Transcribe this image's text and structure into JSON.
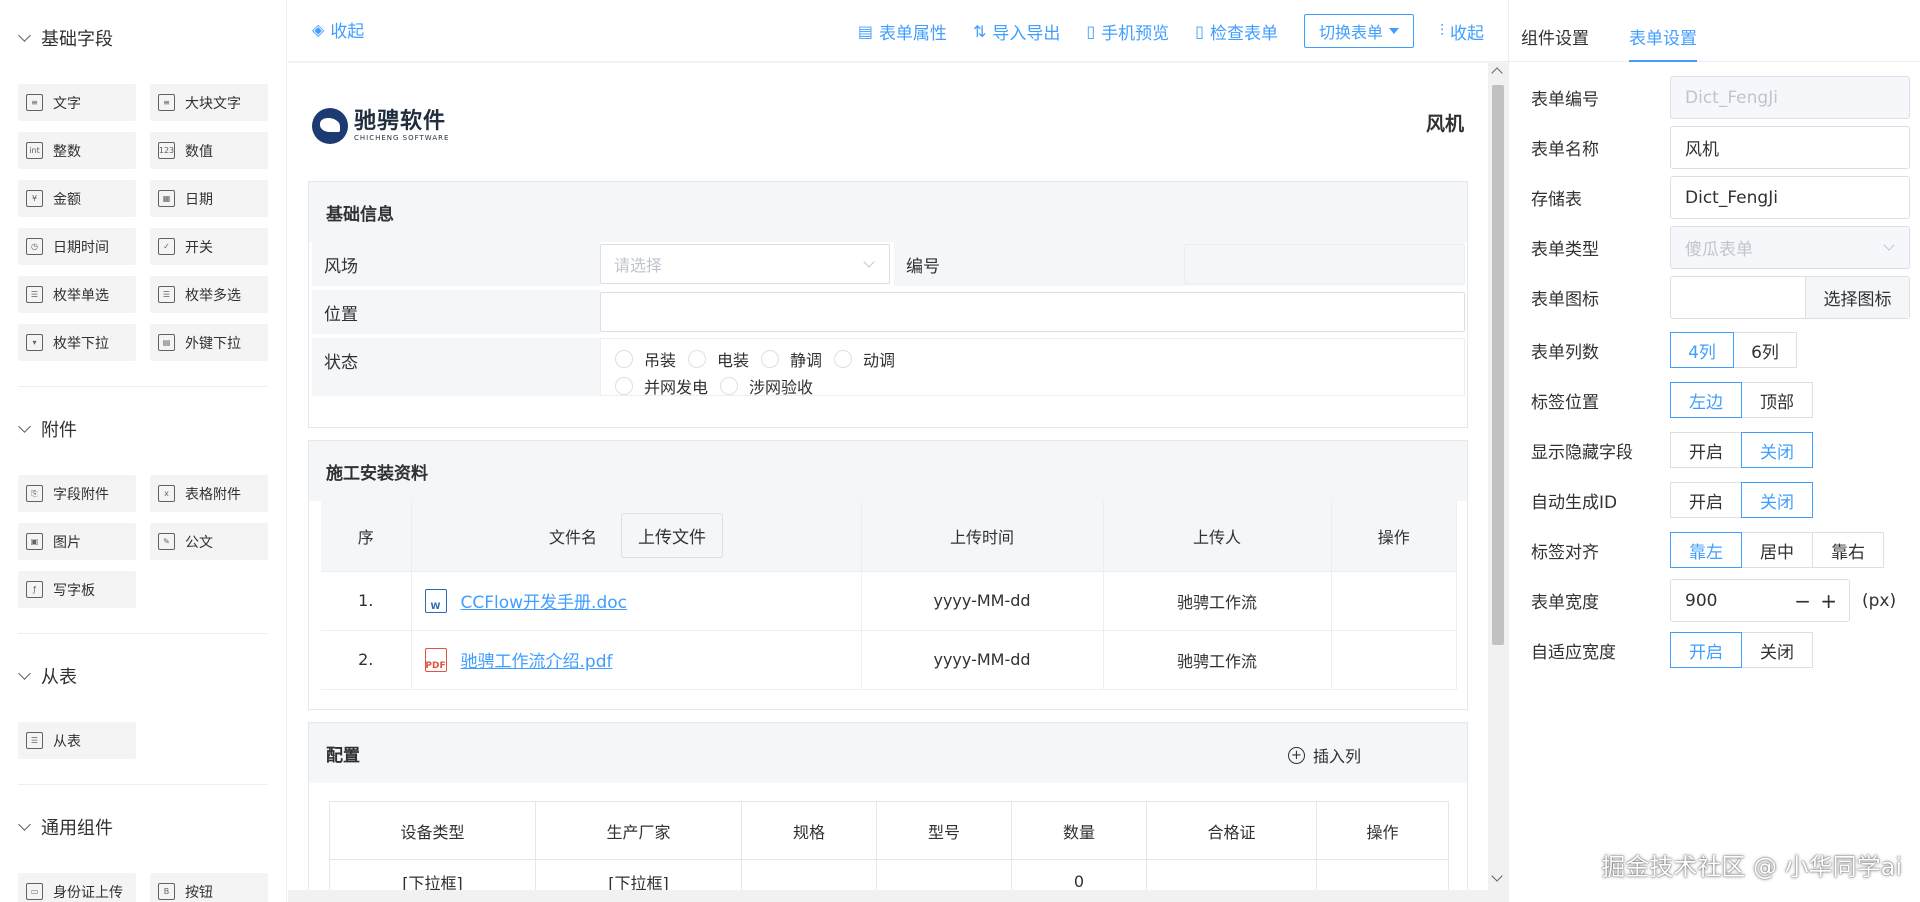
{
  "left": {
    "groups": [
      {
        "title": "基础字段",
        "items": [
          {
            "label": "文字",
            "icon": "text-icon"
          },
          {
            "label": "大块文字",
            "icon": "textarea-icon"
          },
          {
            "label": "整数",
            "icon": "int-icon"
          },
          {
            "label": "数值",
            "icon": "number-icon"
          },
          {
            "label": "金额",
            "icon": "money-icon"
          },
          {
            "label": "日期",
            "icon": "calendar-icon"
          },
          {
            "label": "日期时间",
            "icon": "datetime-icon"
          },
          {
            "label": "开关",
            "icon": "checkbox-icon"
          },
          {
            "label": "枚举单选",
            "icon": "radio-list-icon"
          },
          {
            "label": "枚举多选",
            "icon": "multi-select-icon"
          },
          {
            "label": "枚举下拉",
            "icon": "dropdown-icon"
          },
          {
            "label": "外键下拉",
            "icon": "foreign-key-icon"
          }
        ]
      },
      {
        "title": "附件",
        "items": [
          {
            "label": "字段附件",
            "icon": "file-icon"
          },
          {
            "label": "表格附件",
            "icon": "table-file-icon"
          },
          {
            "label": "图片",
            "icon": "image-icon"
          },
          {
            "label": "公文",
            "icon": "document-icon"
          },
          {
            "label": "写字板",
            "icon": "signature-icon"
          }
        ]
      },
      {
        "title": "从表",
        "items": [
          {
            "label": "从表",
            "icon": "sub-table-icon"
          }
        ]
      },
      {
        "title": "通用组件",
        "items": [
          {
            "label": "身份证上传",
            "icon": "id-card-icon"
          },
          {
            "label": "按钮",
            "icon": "button-icon"
          }
        ]
      }
    ]
  },
  "toolbar": {
    "collapse_left": "收起",
    "form_props": "表单属性",
    "import_export": "导入导出",
    "mobile_preview": "手机预览",
    "check_form": "检查表单",
    "switch_form": "切换表单",
    "collapse_right": "收起"
  },
  "form": {
    "logo_cn": "驰骋软件",
    "logo_en": "CHICHENG SOFTWARE",
    "name": "风机",
    "basic": {
      "title": "基础信息",
      "field_site": "风场",
      "site_placeholder": "请选择",
      "field_code": "编号",
      "field_position": "位置",
      "field_status": "状态",
      "status_options": [
        "吊装",
        "电装",
        "静调",
        "动调",
        "并网发电",
        "涉网验收"
      ]
    },
    "attachments": {
      "title": "施工安装资料",
      "headers": {
        "seq": "序",
        "filename": "文件名",
        "upload_btn": "上传文件",
        "time": "上传时间",
        "uploader": "上传人",
        "action": "操作"
      },
      "rows": [
        {
          "seq": "1.",
          "name": "CCFlow开发手册.doc",
          "type": "word",
          "time": "yyyy-MM-dd",
          "uploader": "驰骋工作流"
        },
        {
          "seq": "2.",
          "name": "驰骋工作流介绍.pdf",
          "type": "pdf",
          "time": "yyyy-MM-dd",
          "uploader": "驰骋工作流"
        }
      ]
    },
    "config": {
      "title": "配置",
      "insert_col": "插入列",
      "headers": [
        "设备类型",
        "生产厂家",
        "规格",
        "型号",
        "数量",
        "合格证",
        "操作"
      ],
      "row": [
        "[下拉框]",
        "[下拉框]",
        "",
        "",
        "0",
        "",
        ""
      ]
    }
  },
  "right": {
    "tabs": [
      "组件设置",
      "表单设置"
    ],
    "active_tab": 1,
    "form_no_label": "表单编号",
    "form_no": "Dict_FengJi",
    "form_name_label": "表单名称",
    "form_name": "风机",
    "storage_label": "存储表",
    "storage": "Dict_FengJi",
    "type_label": "表单类型",
    "type": "傻瓜表单",
    "icon_label": "表单图标",
    "icon_btn": "选择图标",
    "cols_label": "表单列数",
    "cols_options": [
      "4列",
      "6列"
    ],
    "label_pos_label": "标签位置",
    "label_pos_options": [
      "左边",
      "顶部"
    ],
    "hidden_label": "显示隐藏字段",
    "hidden_options": [
      "开启",
      "关闭"
    ],
    "autoid_label": "自动生成ID",
    "autoid_options": [
      "开启",
      "关闭"
    ],
    "align_label": "标签对齐",
    "align_options": [
      "靠左",
      "居中",
      "靠右"
    ],
    "width_label": "表单宽度",
    "width": "900",
    "width_unit": "(px)",
    "adaptive_label": "自适应宽度",
    "adaptive_options": [
      "开启",
      "关闭"
    ]
  },
  "watermark": "掘金技术社区 @ 小华同学ai",
  "colors": {
    "accent": "#409eff",
    "header_bg": "#f5f6f7"
  }
}
